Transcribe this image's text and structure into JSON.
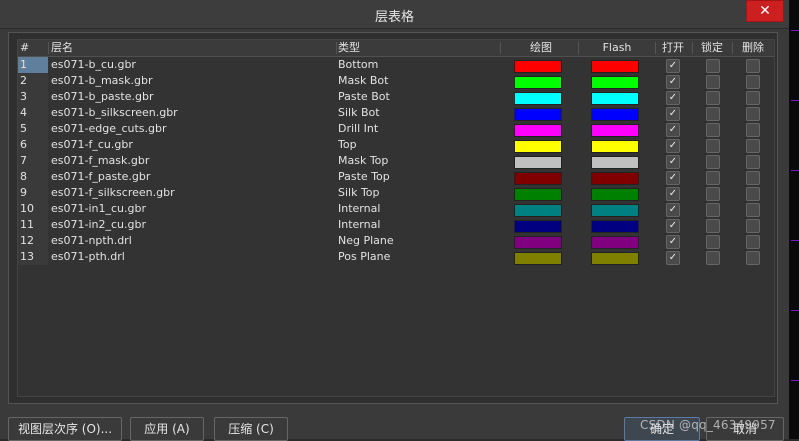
{
  "window": {
    "title": "层表格"
  },
  "table": {
    "columns": {
      "num": "#",
      "name": "层名",
      "type": "类型",
      "draw": "绘图",
      "flash": "Flash",
      "open": "打开",
      "lock": "锁定",
      "del": "删除"
    },
    "rows": [
      {
        "num": "1",
        "name": "es071-b_cu.gbr",
        "type": "Bottom",
        "draw": "#ff0000",
        "flash": "#ff0000",
        "open": true,
        "lock": false,
        "del": false
      },
      {
        "num": "2",
        "name": "es071-b_mask.gbr",
        "type": "Mask Bot",
        "draw": "#00ff00",
        "flash": "#00ff00",
        "open": true,
        "lock": false,
        "del": false
      },
      {
        "num": "3",
        "name": "es071-b_paste.gbr",
        "type": "Paste Bot",
        "draw": "#00ffff",
        "flash": "#00ffff",
        "open": true,
        "lock": false,
        "del": false
      },
      {
        "num": "4",
        "name": "es071-b_silkscreen.gbr",
        "type": "Silk Bot",
        "draw": "#0000ff",
        "flash": "#0000ff",
        "open": true,
        "lock": false,
        "del": false
      },
      {
        "num": "5",
        "name": "es071-edge_cuts.gbr",
        "type": "Drill Int",
        "draw": "#ff00ff",
        "flash": "#ff00ff",
        "open": true,
        "lock": false,
        "del": false
      },
      {
        "num": "6",
        "name": "es071-f_cu.gbr",
        "type": "Top",
        "draw": "#ffff00",
        "flash": "#ffff00",
        "open": true,
        "lock": false,
        "del": false
      },
      {
        "num": "7",
        "name": "es071-f_mask.gbr",
        "type": "Mask Top",
        "draw": "#c0c0c0",
        "flash": "#c0c0c0",
        "open": true,
        "lock": false,
        "del": false
      },
      {
        "num": "8",
        "name": "es071-f_paste.gbr",
        "type": "Paste Top",
        "draw": "#800000",
        "flash": "#800000",
        "open": true,
        "lock": false,
        "del": false
      },
      {
        "num": "9",
        "name": "es071-f_silkscreen.gbr",
        "type": "Silk Top",
        "draw": "#008000",
        "flash": "#008000",
        "open": true,
        "lock": false,
        "del": false
      },
      {
        "num": "10",
        "name": "es071-in1_cu.gbr",
        "type": "Internal",
        "draw": "#008080",
        "flash": "#008080",
        "open": true,
        "lock": false,
        "del": false
      },
      {
        "num": "11",
        "name": "es071-in2_cu.gbr",
        "type": "Internal",
        "draw": "#000080",
        "flash": "#000080",
        "open": true,
        "lock": false,
        "del": false
      },
      {
        "num": "12",
        "name": "es071-npth.drl",
        "type": "Neg Plane",
        "draw": "#800080",
        "flash": "#800080",
        "open": true,
        "lock": false,
        "del": false
      },
      {
        "num": "13",
        "name": "es071-pth.drl",
        "type": "Pos Plane",
        "draw": "#808000",
        "flash": "#808000",
        "open": true,
        "lock": false,
        "del": false
      }
    ],
    "checkmark": "✓"
  },
  "buttons": {
    "view_order": "视图层次序 (O)...",
    "apply": "应用 (A)",
    "compress": "压缩 (C)",
    "ok": "确定",
    "cancel": "取消"
  },
  "watermark": "CSDN @qq_46349957",
  "close_icon": "✕"
}
